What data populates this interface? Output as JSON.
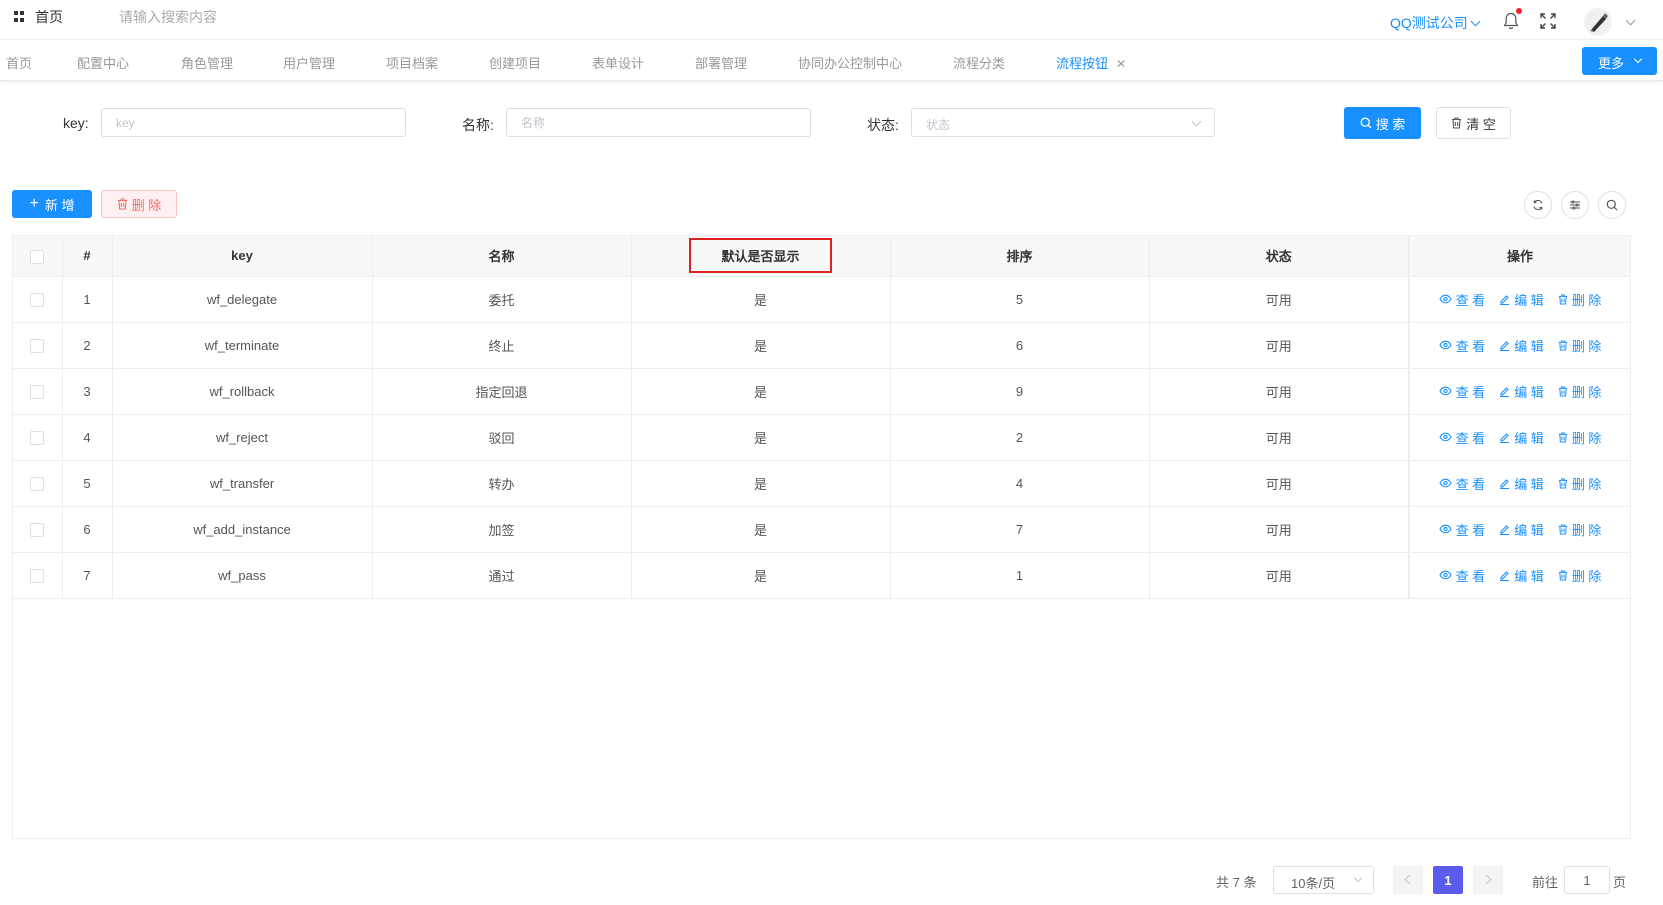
{
  "header": {
    "home_label": "首页",
    "search_placeholder": "请输入搜索内容",
    "company": "QQ测试公司"
  },
  "tabs": [
    {
      "label": "首页"
    },
    {
      "label": "配置中心"
    },
    {
      "label": "角色管理"
    },
    {
      "label": "用户管理"
    },
    {
      "label": "项目档案"
    },
    {
      "label": "创建项目"
    },
    {
      "label": "表单设计"
    },
    {
      "label": "部署管理"
    },
    {
      "label": "协同办公控制中心"
    },
    {
      "label": "流程分类"
    },
    {
      "label": "流程按钮",
      "active": true
    }
  ],
  "more_label": "更多",
  "search": {
    "key_label": "key:",
    "key_placeholder": "key",
    "name_label": "名称:",
    "name_placeholder": "名称",
    "status_label": "状态:",
    "status_placeholder": "状态",
    "search_btn": "搜 索",
    "clear_btn": "清 空"
  },
  "toolbar": {
    "add_btn": "新 增",
    "delete_btn": "删 除"
  },
  "table": {
    "headers": [
      "#",
      "key",
      "名称",
      "默认是否显示",
      "排序",
      "状态",
      "操作"
    ],
    "actions": [
      "查 看",
      "编 辑",
      "删 除"
    ],
    "rows": [
      {
        "idx": "1",
        "key": "wf_delegate",
        "name": "委托",
        "show": "是",
        "sort": "5",
        "status": "可用"
      },
      {
        "idx": "2",
        "key": "wf_terminate",
        "name": "终止",
        "show": "是",
        "sort": "6",
        "status": "可用"
      },
      {
        "idx": "3",
        "key": "wf_rollback",
        "name": "指定回退",
        "show": "是",
        "sort": "9",
        "status": "可用"
      },
      {
        "idx": "4",
        "key": "wf_reject",
        "name": "驳回",
        "show": "是",
        "sort": "2",
        "status": "可用"
      },
      {
        "idx": "5",
        "key": "wf_transfer",
        "name": "转办",
        "show": "是",
        "sort": "4",
        "status": "可用"
      },
      {
        "idx": "6",
        "key": "wf_add_instance",
        "name": "加签",
        "show": "是",
        "sort": "7",
        "status": "可用"
      },
      {
        "idx": "7",
        "key": "wf_pass",
        "name": "通过",
        "show": "是",
        "sort": "1",
        "status": "可用"
      }
    ]
  },
  "pagination": {
    "total": "共 7 条",
    "page_size": "10条/页",
    "current": "1",
    "goto_label": "前往",
    "goto_value": "1",
    "page_label": "页"
  },
  "colors": {
    "primary": "#1890ff",
    "danger": "#f56c6c",
    "highlight_border": "#e02020",
    "current_page": "#5b5bf0"
  }
}
